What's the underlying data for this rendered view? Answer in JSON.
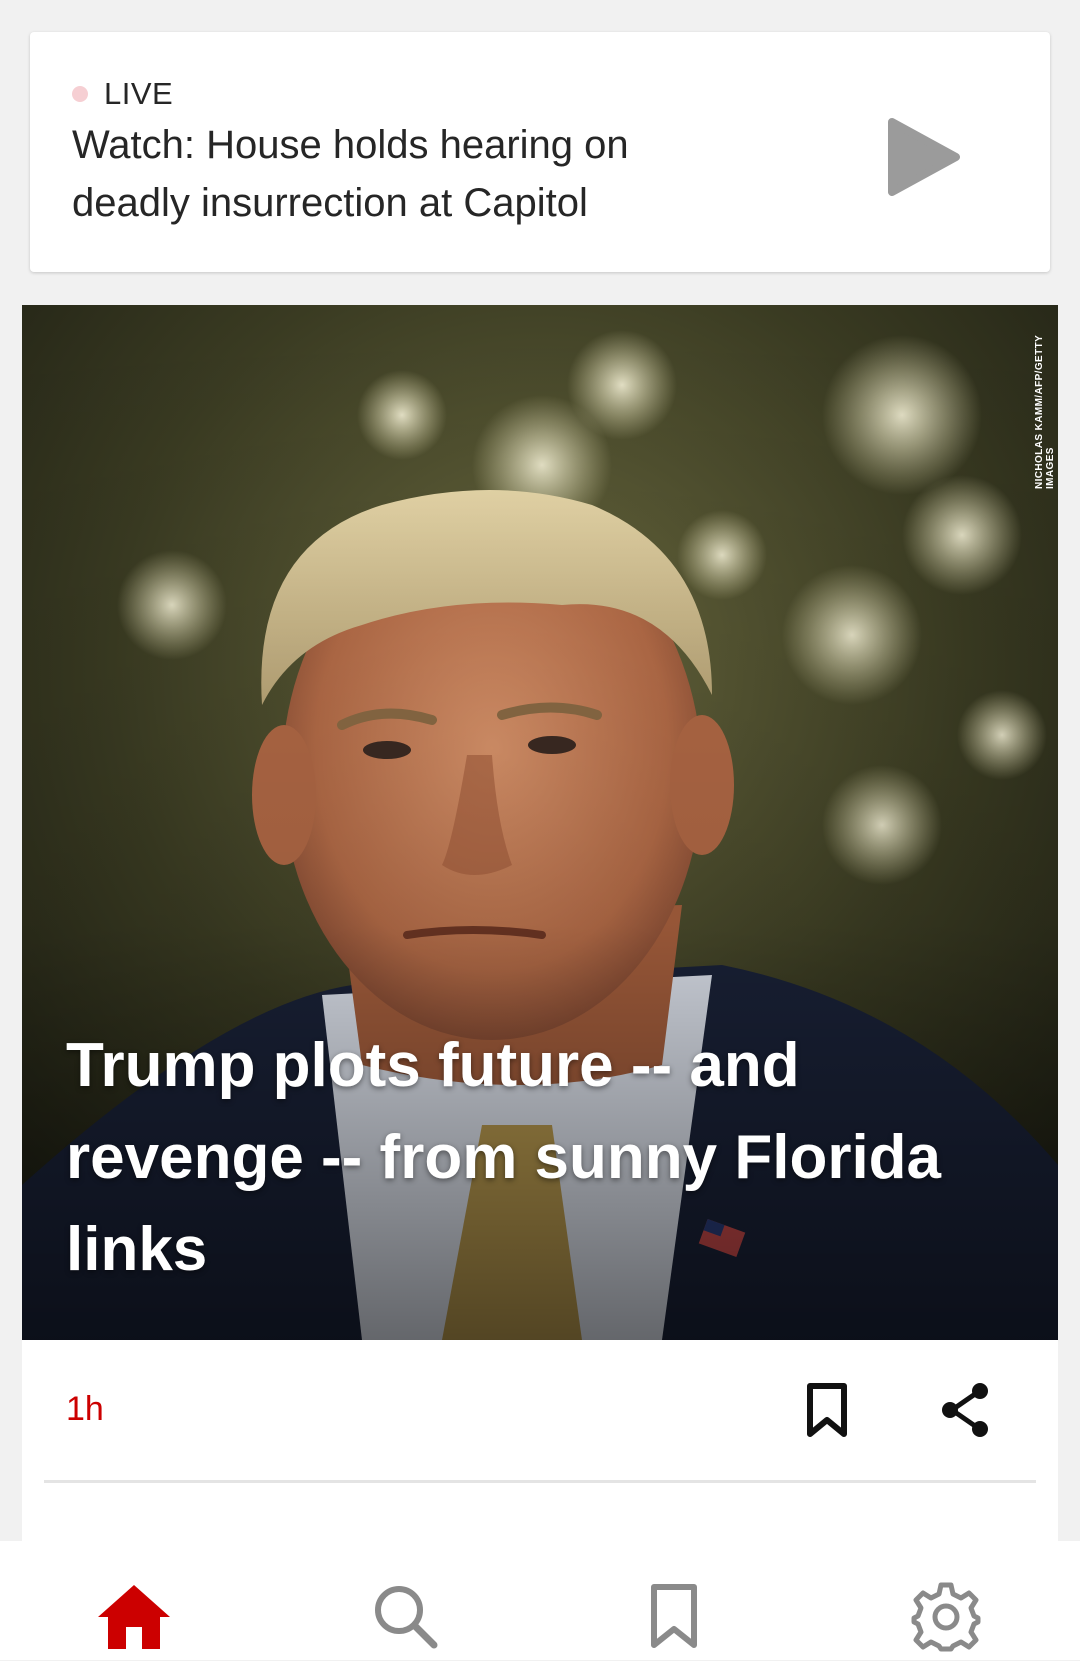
{
  "live": {
    "label": "LIVE",
    "title": "Watch: House holds hearing on deadly insurrection at Capitol"
  },
  "story": {
    "headline": "Trump plots future -- and revenge -- from sunny Florida links",
    "image_credit": "NICHOLAS KAMM/AFP/GETTY IMAGES",
    "timestamp": "1h"
  },
  "icons": {
    "play": "play-icon",
    "bookmark": "bookmark-icon",
    "share": "share-icon",
    "home": "home-icon",
    "search": "search-icon",
    "saved": "bookmark-icon",
    "settings": "gear-icon"
  },
  "colors": {
    "accent": "#cc0000",
    "live_dot": "#f6cfd3",
    "nav_inactive": "#8a8a8a"
  }
}
